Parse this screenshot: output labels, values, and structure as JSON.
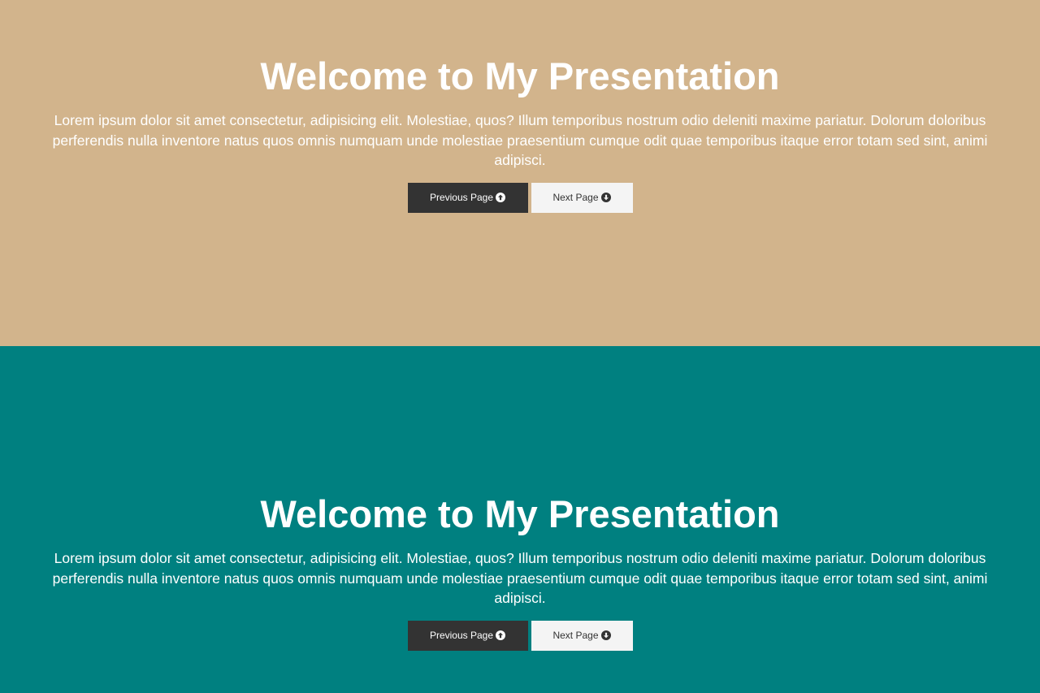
{
  "colors": {
    "slide1_bg": "#d2b48c",
    "slide2_bg": "#008080",
    "prev_button_bg": "#333333",
    "next_button_bg": "#f4f4f4"
  },
  "slides": [
    {
      "title": "Welcome to My Presentation",
      "body": "Lorem ipsum dolor sit amet consectetur, adipisicing elit. Molestiae, quos? Illum temporibus nostrum odio deleniti maxime pariatur. Dolorum doloribus perferendis nulla inventore natus quos omnis numquam unde molestiae praesentium cumque odit quae temporibus itaque error totam sed sint, animi adipisci.",
      "prev_label": "Previous Page",
      "prev_icon": "arrow-circle-up-icon",
      "next_label": "Next Page",
      "next_icon": "arrow-circle-down-icon"
    },
    {
      "title": "Welcome to My Presentation",
      "body": "Lorem ipsum dolor sit amet consectetur, adipisicing elit. Molestiae, quos? Illum temporibus nostrum odio deleniti maxime pariatur. Dolorum doloribus perferendis nulla inventore natus quos omnis numquam unde molestiae praesentium cumque odit quae temporibus itaque error totam sed sint, animi adipisci.",
      "prev_label": "Previous Page",
      "prev_icon": "arrow-circle-up-icon",
      "next_label": "Next Page",
      "next_icon": "arrow-circle-down-icon"
    }
  ]
}
